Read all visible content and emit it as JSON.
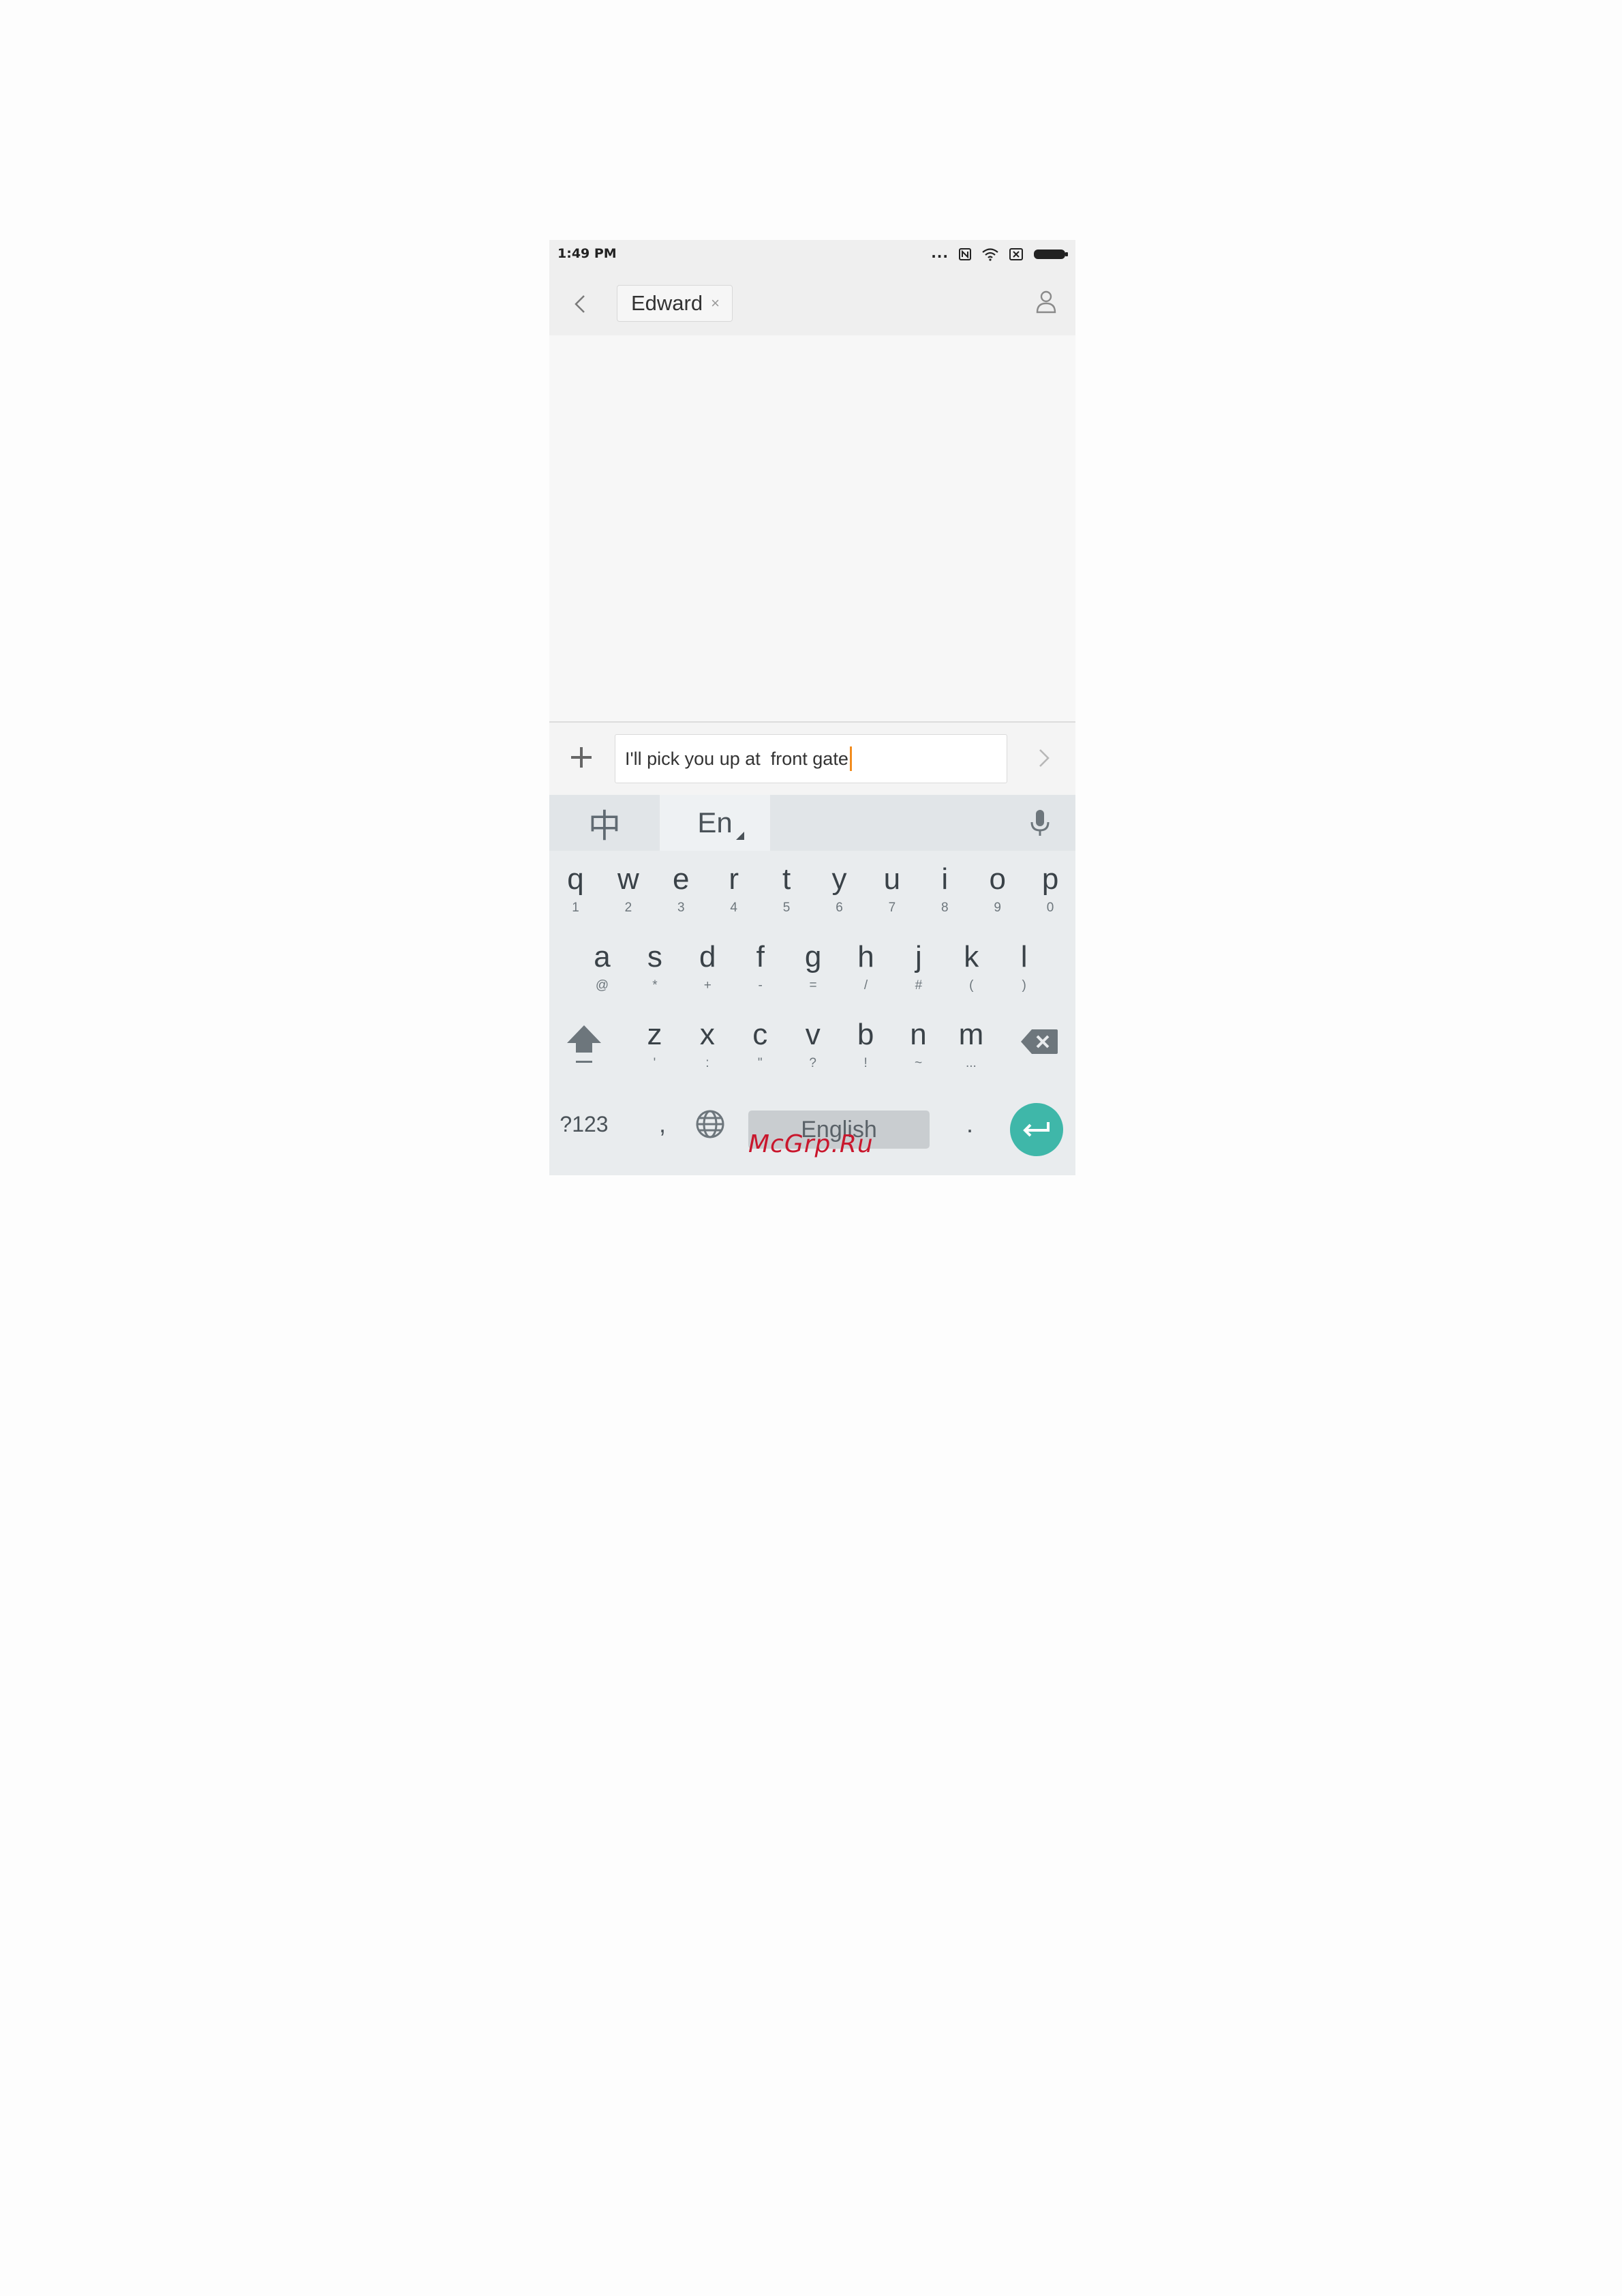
{
  "status_bar": {
    "time": "1:49 PM",
    "icons": [
      "more-dots-icon",
      "nfc-icon",
      "wifi-icon",
      "no-sim-icon",
      "battery-icon"
    ],
    "dots": "..."
  },
  "header": {
    "back_icon": "chevron-left-icon",
    "recipient": "Edward",
    "recipient_remove": "×",
    "contact_icon": "person-icon"
  },
  "compose": {
    "add_icon": "plus-icon",
    "message": "I'll pick you up at  front gate",
    "send_icon": "chevron-right-icon"
  },
  "keyboard": {
    "lang_zh": "中",
    "lang_en": "En",
    "mic_icon": "mic-icon",
    "row1": [
      {
        "k": "q",
        "s": "1"
      },
      {
        "k": "w",
        "s": "2"
      },
      {
        "k": "e",
        "s": "3"
      },
      {
        "k": "r",
        "s": "4"
      },
      {
        "k": "t",
        "s": "5"
      },
      {
        "k": "y",
        "s": "6"
      },
      {
        "k": "u",
        "s": "7"
      },
      {
        "k": "i",
        "s": "8"
      },
      {
        "k": "o",
        "s": "9"
      },
      {
        "k": "p",
        "s": "0"
      }
    ],
    "row2": [
      {
        "k": "a",
        "s": "@"
      },
      {
        "k": "s",
        "s": "*"
      },
      {
        "k": "d",
        "s": "+"
      },
      {
        "k": "f",
        "s": "-"
      },
      {
        "k": "g",
        "s": "="
      },
      {
        "k": "h",
        "s": "/"
      },
      {
        "k": "j",
        "s": "#"
      },
      {
        "k": "k",
        "s": "("
      },
      {
        "k": "l",
        "s": ")"
      }
    ],
    "row3": [
      {
        "k": "z",
        "s": "'"
      },
      {
        "k": "x",
        "s": ":"
      },
      {
        "k": "c",
        "s": "\""
      },
      {
        "k": "v",
        "s": "?"
      },
      {
        "k": "b",
        "s": "!"
      },
      {
        "k": "n",
        "s": "~"
      },
      {
        "k": "m",
        "s": "..."
      }
    ],
    "symbols": "?123",
    "comma": ",",
    "space": "English",
    "period": ".",
    "shift_icon": "shift-arrow-icon",
    "backspace_icon": "backspace-icon",
    "globe_icon": "globe-icon",
    "enter_icon": "enter-icon"
  },
  "watermark": "McGrp.Ru",
  "colors": {
    "accent": "#3fb7a9",
    "caret": "#f28c1e",
    "watermark": "#c9162c"
  }
}
